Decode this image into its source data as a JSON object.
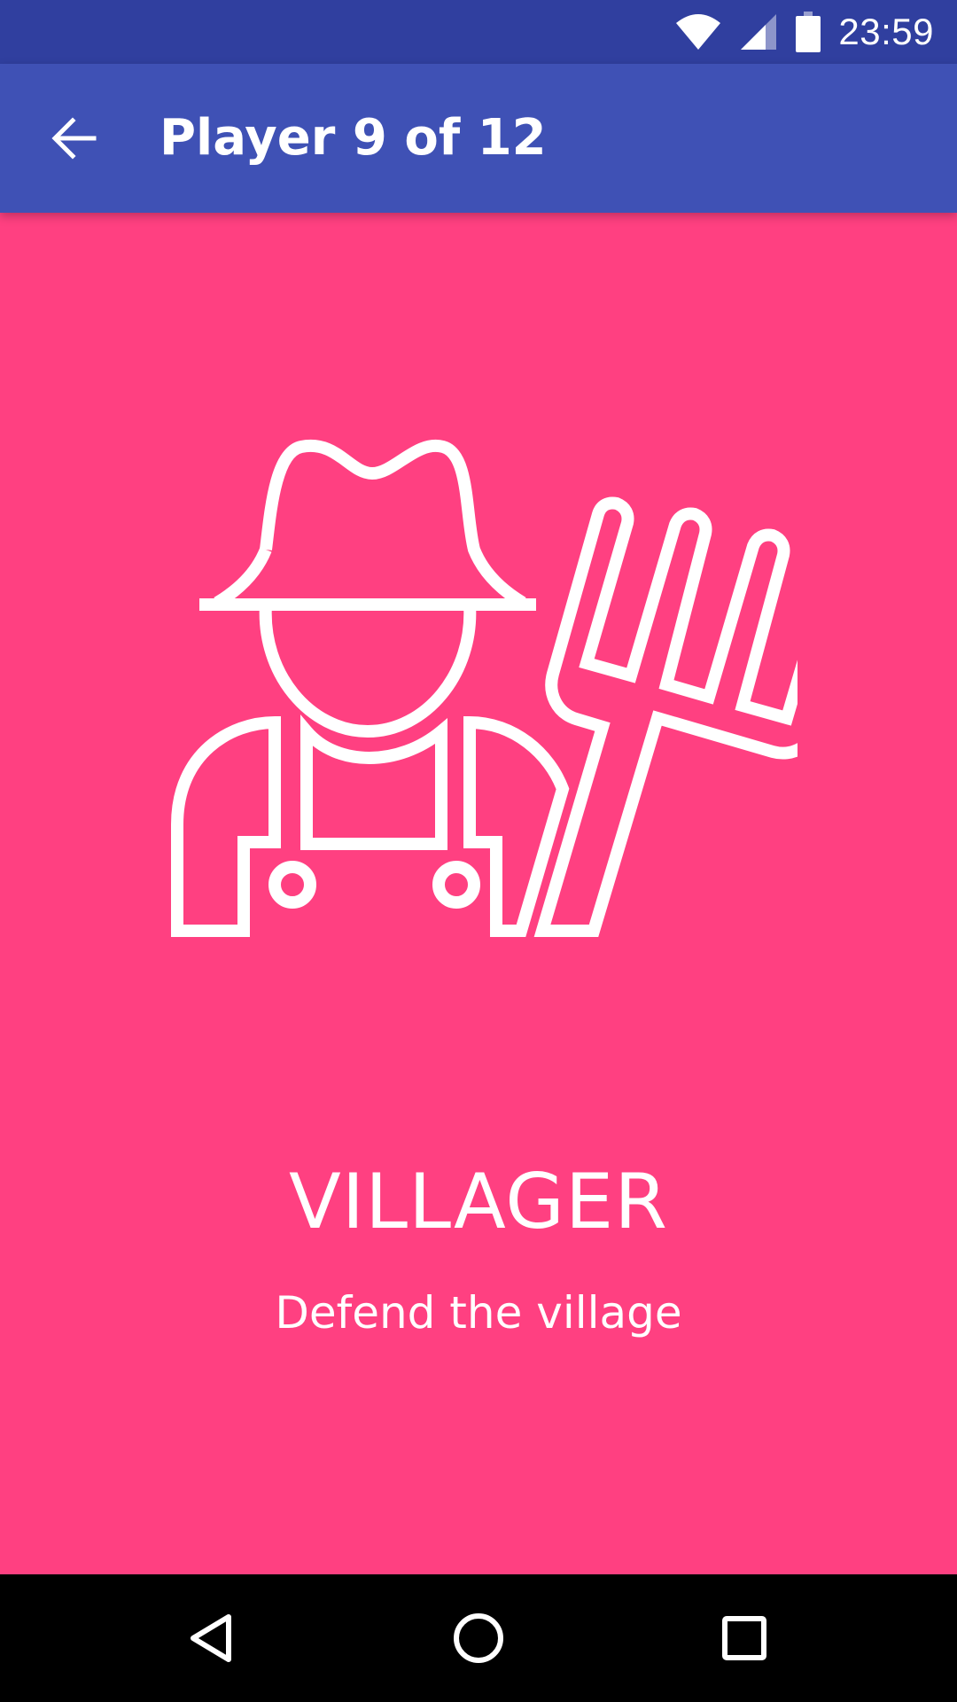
{
  "status_bar": {
    "time": "23:59",
    "icons": [
      "wifi-icon",
      "signal-icon",
      "battery-icon"
    ]
  },
  "app_bar": {
    "title": "Player 9 of 12",
    "back_icon": "arrow-back-icon"
  },
  "role": {
    "name": "VILLAGER",
    "description": "Defend the village",
    "illustration": "farmer-with-pitchfork"
  },
  "nav_bar": {
    "icons": [
      "back-triangle-icon",
      "home-circle-icon",
      "recents-square-icon"
    ]
  },
  "colors": {
    "status_bar": "#303F9F",
    "app_bar": "#3F51B5",
    "background": "#FF4081",
    "text": "#FFFFFF",
    "nav_bar": "#000000"
  }
}
